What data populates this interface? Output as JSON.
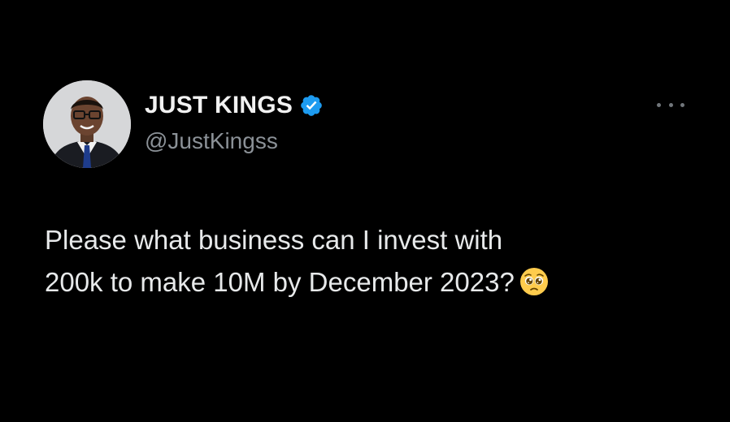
{
  "author": {
    "display_name": "JUST KINGS",
    "handle": "@JustKingss",
    "verified": true,
    "avatar_icon": "profile-photo",
    "badge_color": "#1d9bf0"
  },
  "menu": {
    "icon": "more-horizontal-icon"
  },
  "tweet": {
    "line1": "Please what business can I invest with",
    "line2": "200k to make 10M by December 2023?",
    "emoji": "pleading-face-emoji"
  },
  "colors": {
    "background": "#000000",
    "text": "#e7e9ea",
    "secondary": "#8b9197"
  }
}
